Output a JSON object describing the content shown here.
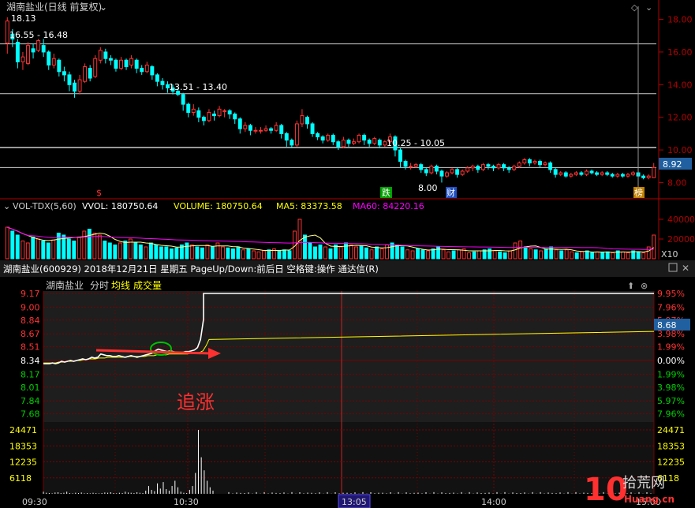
{
  "colors": {
    "up": "#ff3333",
    "down": "#00e5ee",
    "axis": "#b40000",
    "grid": "#7a0000",
    "white": "#ffffff",
    "yellow": "#ffff00",
    "magenta": "#ff00ff",
    "cyan": "#00ffff",
    "green": "#00d000",
    "label": "#d0d0d0"
  },
  "top": {
    "title": "湖南盐业(日线 前复权)",
    "price_ticks": [
      "18.00",
      "16.00",
      "14.00",
      "12.00",
      "10.00",
      "8.00"
    ],
    "current_price": "8.92",
    "annotations": {
      "high": "18.13",
      "band1": "16.55 - 16.48",
      "band2": "13.51 - 13.40",
      "band3": "10.25 - 10.05",
      "low": "8.00"
    },
    "markers": {
      "s": "$",
      "die": "跌",
      "cai": "财",
      "bang": "榜"
    }
  },
  "vol": {
    "legend": {
      "name": "VOL-TDX(5,60)",
      "vvol": "VVOL: 180750.64",
      "volume": "VOLUME: 180750.64",
      "ma5": "MA5: 83373.58",
      "ma60": "MA60: 84220.16"
    },
    "ticks": [
      "40000",
      "20000"
    ],
    "unit": "X10"
  },
  "bottom": {
    "header": "湖南盐业(600929)  2018年12月21日 星期五  PageUp/Down:前后日  空格键:操作  通达信(R)",
    "tabs": {
      "name": "湖南盐业",
      "fenshi": "分时",
      "junxian": "均线",
      "chengjiao": "成交量"
    },
    "left_prices": [
      "9.17",
      "9.00",
      "8.84",
      "8.67",
      "8.51",
      "8.34",
      "8.17",
      "8.01",
      "7.84",
      "7.68"
    ],
    "right_pcts": [
      "9.95%",
      "7.96%",
      "5.97%",
      "3.98%",
      "1.99%",
      "0.00%",
      "1.99%",
      "3.98%",
      "5.97%",
      "7.96%"
    ],
    "current_price": "8.68",
    "vol_ticks": [
      "24471",
      "18353",
      "12235",
      "6118"
    ],
    "time_ticks": [
      "09:30",
      "10:30",
      "13:05",
      "14:00",
      "15:00"
    ],
    "annotation": "追涨"
  },
  "watermark": "10 拾荒网 Huang.cn",
  "chart_data": [
    {
      "type": "candlestick",
      "title": "湖南盐业(日线 前复权)",
      "ylim": [
        7.2,
        18.8
      ],
      "candles": [
        [
          16.55,
          17.9,
          15.9,
          18.13
        ],
        [
          17.1,
          16.8,
          16.3,
          17.4
        ],
        [
          16.6,
          15.4,
          15.0,
          16.8
        ],
        [
          15.4,
          15.7,
          14.9,
          16.0
        ],
        [
          15.3,
          16.4,
          15.2,
          16.6
        ],
        [
          16.2,
          16.0,
          15.6,
          16.5
        ],
        [
          16.1,
          16.7,
          16.0,
          16.8
        ],
        [
          16.4,
          16.0,
          15.7,
          16.8
        ],
        [
          16.0,
          15.2,
          14.9,
          16.1
        ],
        [
          15.2,
          15.6,
          15.0,
          15.9
        ],
        [
          15.5,
          14.8,
          14.5,
          15.6
        ],
        [
          14.8,
          14.6,
          14.2,
          15.1
        ],
        [
          14.6,
          14.0,
          13.6,
          14.8
        ],
        [
          14.1,
          13.6,
          13.2,
          14.3
        ],
        [
          13.6,
          14.3,
          13.4,
          14.6
        ],
        [
          14.2,
          15.1,
          14.1,
          15.3
        ],
        [
          15.0,
          14.4,
          14.2,
          15.2
        ],
        [
          14.5,
          15.6,
          14.4,
          15.8
        ],
        [
          15.5,
          16.1,
          15.3,
          16.3
        ],
        [
          16.0,
          15.6,
          15.3,
          16.2
        ],
        [
          15.6,
          15.5,
          15.2,
          15.8
        ],
        [
          15.5,
          15.0,
          14.8,
          15.6
        ],
        [
          15.0,
          15.5,
          14.9,
          15.7
        ],
        [
          15.5,
          15.1,
          14.9,
          15.6
        ],
        [
          15.2,
          15.6,
          15.0,
          15.8
        ],
        [
          15.5,
          15.0,
          14.7,
          15.6
        ],
        [
          15.0,
          14.8,
          14.6,
          15.2
        ],
        [
          14.8,
          15.2,
          14.7,
          15.4
        ],
        [
          15.1,
          14.6,
          14.3,
          15.2
        ],
        [
          14.6,
          14.2,
          13.9,
          14.7
        ],
        [
          14.2,
          14.0,
          13.7,
          14.4
        ],
        [
          14.0,
          13.8,
          13.5,
          14.2
        ],
        [
          13.8,
          13.6,
          13.4,
          14.0
        ],
        [
          13.6,
          13.4,
          13.3,
          13.8
        ],
        [
          13.4,
          12.8,
          12.4,
          13.5
        ],
        [
          12.8,
          12.3,
          12.0,
          12.9
        ],
        [
          12.3,
          12.5,
          12.1,
          12.8
        ],
        [
          12.4,
          12.0,
          11.7,
          12.6
        ],
        [
          12.0,
          11.8,
          11.5,
          12.1
        ],
        [
          11.8,
          12.3,
          11.7,
          12.5
        ],
        [
          12.2,
          12.1,
          11.8,
          12.4
        ],
        [
          12.1,
          12.5,
          12.0,
          12.7
        ],
        [
          12.4,
          12.4,
          12.0,
          12.5
        ],
        [
          12.4,
          12.2,
          11.9,
          12.5
        ],
        [
          12.2,
          11.9,
          11.6,
          12.3
        ],
        [
          11.9,
          11.3,
          11.0,
          12.0
        ],
        [
          11.3,
          11.5,
          11.1,
          11.7
        ],
        [
          11.5,
          11.2,
          10.9,
          11.6
        ],
        [
          11.2,
          11.2,
          11.0,
          11.4
        ],
        [
          11.2,
          11.2,
          11.0,
          11.4
        ],
        [
          11.2,
          11.3,
          11.1,
          11.5
        ],
        [
          11.3,
          11.2,
          11.0,
          11.4
        ],
        [
          11.2,
          11.5,
          11.1,
          11.7
        ],
        [
          11.5,
          11.0,
          10.7,
          11.6
        ],
        [
          11.0,
          10.6,
          10.2,
          11.1
        ],
        [
          10.6,
          10.3,
          10.1,
          10.7
        ],
        [
          10.3,
          11.6,
          10.2,
          11.8
        ],
        [
          11.6,
          12.1,
          11.4,
          12.5
        ],
        [
          12.0,
          11.6,
          11.3,
          12.1
        ],
        [
          11.6,
          11.0,
          10.8,
          11.7
        ],
        [
          11.0,
          10.8,
          10.6,
          11.1
        ],
        [
          10.8,
          10.6,
          10.4,
          10.9
        ],
        [
          10.6,
          10.9,
          10.5,
          11.0
        ],
        [
          10.9,
          10.5,
          10.3,
          11.0
        ],
        [
          10.5,
          10.2,
          10.0,
          10.6
        ],
        [
          10.2,
          10.6,
          10.1,
          10.8
        ],
        [
          10.6,
          10.4,
          10.2,
          10.7
        ],
        [
          10.4,
          10.5,
          10.3,
          10.7
        ],
        [
          10.5,
          10.9,
          10.4,
          11.0
        ],
        [
          10.9,
          10.6,
          10.3,
          11.0
        ],
        [
          10.6,
          10.4,
          10.2,
          10.7
        ],
        [
          10.4,
          10.7,
          10.3,
          10.8
        ],
        [
          10.6,
          10.3,
          10.1,
          10.7
        ],
        [
          10.3,
          10.5,
          10.2,
          10.6
        ],
        [
          10.5,
          10.8,
          10.4,
          11.0
        ],
        [
          10.8,
          10.0,
          9.6,
          10.9
        ],
        [
          10.0,
          9.3,
          8.9,
          10.1
        ],
        [
          9.3,
          9.0,
          8.8,
          9.4
        ],
        [
          9.0,
          9.0,
          8.8,
          9.2
        ],
        [
          9.0,
          9.1,
          8.9,
          9.2
        ],
        [
          9.1,
          8.8,
          8.6,
          9.2
        ],
        [
          8.8,
          8.6,
          8.4,
          8.9
        ],
        [
          8.6,
          9.0,
          8.5,
          9.1
        ],
        [
          9.0,
          8.7,
          8.5,
          9.1
        ],
        [
          8.7,
          8.4,
          8.0,
          8.8
        ],
        [
          8.4,
          8.6,
          8.3,
          8.7
        ],
        [
          8.6,
          8.8,
          8.5,
          8.9
        ],
        [
          8.8,
          8.5,
          8.3,
          8.9
        ],
        [
          8.5,
          8.7,
          8.4,
          8.8
        ],
        [
          8.7,
          8.9,
          8.6,
          9.0
        ],
        [
          8.9,
          9.0,
          8.7,
          9.1
        ],
        [
          9.0,
          8.8,
          8.6,
          9.1
        ],
        [
          8.8,
          9.1,
          8.7,
          9.2
        ],
        [
          9.1,
          9.0,
          8.8,
          9.2
        ],
        [
          9.0,
          8.9,
          8.7,
          9.1
        ],
        [
          8.9,
          9.1,
          8.8,
          9.2
        ],
        [
          9.1,
          8.9,
          8.7,
          9.2
        ],
        [
          8.9,
          8.8,
          8.6,
          9.0
        ],
        [
          8.8,
          9.0,
          8.7,
          9.1
        ],
        [
          9.0,
          9.2,
          8.9,
          9.3
        ],
        [
          9.2,
          9.4,
          9.1,
          9.5
        ],
        [
          9.4,
          9.2,
          9.0,
          9.5
        ],
        [
          9.2,
          9.3,
          9.1,
          9.4
        ],
        [
          9.3,
          9.1,
          8.9,
          9.4
        ],
        [
          9.1,
          9.2,
          9.0,
          9.3
        ],
        [
          9.2,
          8.8,
          8.6,
          9.3
        ],
        [
          8.8,
          8.5,
          8.3,
          8.9
        ],
        [
          8.5,
          8.6,
          8.4,
          8.7
        ],
        [
          8.6,
          8.4,
          8.3,
          8.7
        ],
        [
          8.4,
          8.5,
          8.3,
          8.6
        ],
        [
          8.5,
          8.6,
          8.4,
          8.7
        ],
        [
          8.6,
          8.5,
          8.4,
          8.7
        ],
        [
          8.5,
          8.7,
          8.4,
          8.8
        ],
        [
          8.7,
          8.6,
          8.5,
          8.8
        ],
        [
          8.6,
          8.5,
          8.4,
          8.7
        ],
        [
          8.5,
          8.6,
          8.4,
          8.7
        ],
        [
          8.6,
          8.5,
          8.4,
          8.7
        ],
        [
          8.5,
          8.4,
          8.3,
          8.6
        ],
        [
          8.4,
          8.5,
          8.3,
          8.6
        ],
        [
          8.5,
          8.4,
          8.3,
          8.6
        ],
        [
          8.4,
          8.5,
          8.3,
          8.6
        ],
        [
          8.5,
          8.6,
          8.4,
          8.7
        ],
        [
          8.6,
          8.4,
          8.3,
          8.7
        ],
        [
          8.4,
          8.3,
          8.2,
          8.5
        ],
        [
          8.3,
          8.4,
          8.2,
          8.5
        ],
        [
          8.3,
          8.92,
          8.3,
          9.2
        ]
      ],
      "levels": [
        16.5,
        13.45,
        10.15,
        8.92
      ]
    },
    {
      "type": "bar",
      "title": "VOL-TDX(5,60)",
      "ylim": [
        0,
        48000
      ],
      "values": [
        32000,
        28000,
        24000,
        18000,
        16000,
        22000,
        20000,
        18000,
        16000,
        19000,
        26000,
        24000,
        20000,
        18000,
        22000,
        28000,
        30000,
        26000,
        24000,
        18000,
        16000,
        14000,
        16000,
        18000,
        20000,
        16000,
        14000,
        12000,
        16000,
        14000,
        12000,
        12000,
        10000,
        11000,
        14000,
        16000,
        14000,
        12000,
        11000,
        14000,
        12000,
        16000,
        12000,
        11000,
        10000,
        12000,
        9000,
        10000,
        8000,
        7000,
        8000,
        9000,
        10000,
        8000,
        9000,
        8000,
        28000,
        40000,
        24000,
        16000,
        12000,
        14000,
        12000,
        10000,
        14000,
        12000,
        16000,
        14000,
        12000,
        13000,
        11000,
        9000,
        12000,
        10000,
        14000,
        16000,
        14000,
        12000,
        9000,
        8000,
        10000,
        9000,
        8000,
        10000,
        12000,
        9000,
        7000,
        8000,
        9000,
        10000,
        6000,
        7000,
        8000,
        9000,
        10000,
        8000,
        7000,
        6000,
        8000,
        16000,
        18000,
        12000,
        10000,
        9000,
        8000,
        10000,
        12000,
        9000,
        8000,
        9000,
        7000,
        6000,
        7000,
        8000,
        6000,
        7000,
        6000,
        7000,
        6000,
        8000,
        7000,
        6000,
        8000,
        7000,
        6000,
        12000,
        24000
      ],
      "ma5_label": "MA5: 83373.58",
      "ma60_label": "MA60: 84220.16"
    },
    {
      "type": "line",
      "title": "分时",
      "ylim": [
        7.6,
        9.2
      ],
      "x": [
        "09:30",
        "10:30",
        "13:05",
        "14:00",
        "15:00"
      ],
      "price": [
        8.3,
        8.3,
        8.3,
        8.31,
        8.3,
        8.31,
        8.33,
        8.32,
        8.33,
        8.34,
        8.33,
        8.34,
        8.35,
        8.36,
        8.35,
        8.36,
        8.38,
        8.37,
        8.38,
        8.42,
        8.41,
        8.4,
        8.4,
        8.39,
        8.39,
        8.4,
        8.39,
        8.38,
        8.39,
        8.4,
        8.39,
        8.38,
        8.39,
        8.4,
        8.41,
        8.42,
        8.43,
        8.46,
        8.48,
        8.47,
        8.46,
        8.45,
        8.46,
        8.45,
        8.44,
        8.44,
        8.44,
        8.45,
        8.45,
        8.46,
        8.47,
        8.5,
        8.6,
        8.85,
        9.17,
        9.17,
        9.17,
        9.17,
        9.17
      ],
      "avg": [
        8.31,
        8.31,
        8.31,
        8.31,
        8.31,
        8.32,
        8.32,
        8.32,
        8.33,
        8.33,
        8.33,
        8.34,
        8.34,
        8.35,
        8.35,
        8.36,
        8.36,
        8.36,
        8.37,
        8.37,
        8.37,
        8.38,
        8.38,
        8.38,
        8.38,
        8.38,
        8.38,
        8.38,
        8.39,
        8.39,
        8.39,
        8.39,
        8.39,
        8.39,
        8.4,
        8.4,
        8.4,
        8.41,
        8.41,
        8.41,
        8.41,
        8.42,
        8.42,
        8.42,
        8.42,
        8.42,
        8.42,
        8.42,
        8.43,
        8.43,
        8.43,
        8.44,
        8.46,
        8.52,
        8.6,
        8.67,
        8.68,
        8.68,
        8.68
      ],
      "annotation": "追涨",
      "current_price": "8.68"
    },
    {
      "type": "bar",
      "title": "成交量",
      "ylim": [
        0,
        26000
      ],
      "values": [
        800,
        400,
        300,
        200,
        500,
        600,
        300,
        400,
        800,
        300,
        200,
        400,
        300,
        500,
        200,
        300,
        200,
        400,
        300,
        200,
        300,
        500,
        400,
        600,
        300,
        200,
        400,
        300,
        800,
        500,
        400,
        300,
        600,
        400,
        300,
        1200,
        3000,
        1500,
        1000,
        4000,
        2000,
        4500,
        1800,
        1200,
        3000,
        5000,
        2500,
        800,
        400,
        300,
        1500,
        3000,
        8000,
        24471,
        14000,
        9000,
        5000,
        2500,
        1200
      ]
    }
  ]
}
